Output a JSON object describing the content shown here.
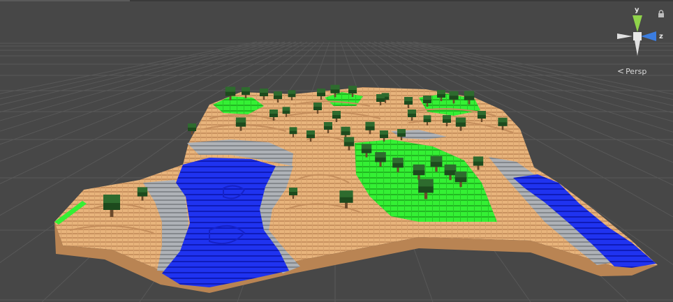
{
  "gizmo": {
    "axis_y": "y",
    "axis_z": "z",
    "colors": {
      "y": "#8fd34a",
      "z": "#3b7de0",
      "x_neg": "#e8e8e8",
      "center": "#e8e8e8"
    },
    "lock_icon": "lock-icon"
  },
  "projection": {
    "label": "Persp",
    "icon": "chevron-left-icon"
  },
  "scene": {
    "colors": {
      "background": "#474747",
      "grid": "#555555",
      "sand": "#e8b47c",
      "sand_dark": "#c28c5c",
      "stone": "#a9adb3",
      "stone_dark": "#7f8388",
      "water": "#1c2fe8",
      "water_dark": "#0d16b0",
      "grass": "#2ff02f",
      "grass_dark": "#1ea01e",
      "tree": "#2e6b2e",
      "tree_dark": "#1d4a1d",
      "trunk": "#6b4a2b"
    }
  }
}
